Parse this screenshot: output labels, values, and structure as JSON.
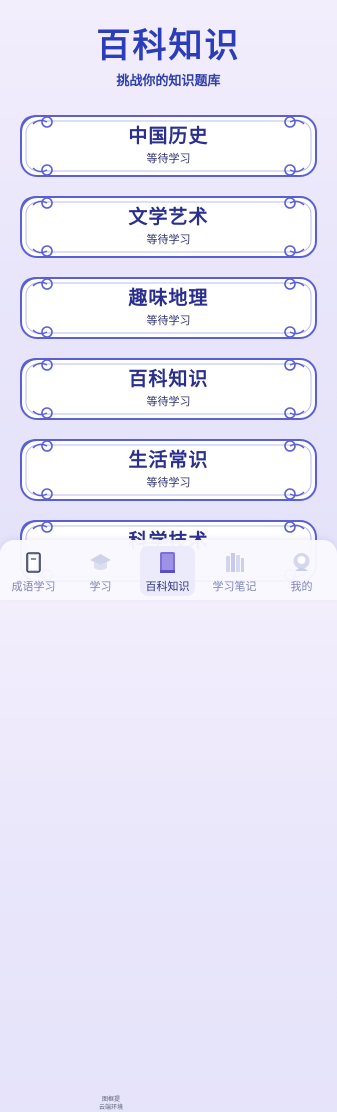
{
  "header": {
    "title": "百科知识",
    "subtitle": "挑战你的知识题库"
  },
  "categories": [
    {
      "name": "中国历史",
      "status": "等待学习"
    },
    {
      "name": "文学艺术",
      "status": "等待学习"
    },
    {
      "name": "趣味地理",
      "status": "等待学习"
    },
    {
      "name": "百科知识",
      "status": "等待学习"
    },
    {
      "name": "生活常识",
      "status": "等待学习"
    },
    {
      "name": "科学技术",
      "status": ""
    }
  ],
  "tabbar": {
    "items": [
      {
        "label": "成语学习",
        "icon": "book-icon"
      },
      {
        "label": "学习",
        "icon": "graduation-cap-icon"
      },
      {
        "label": "百科知识",
        "icon": "encyclopedia-book-icon"
      },
      {
        "label": "学习笔记",
        "icon": "bookshelf-icon"
      },
      {
        "label": "我的",
        "icon": "user-avatar-icon"
      }
    ],
    "active_index": 2,
    "overlay_note_line1": "图框提",
    "overlay_note_line2": "云端环境"
  },
  "colors": {
    "title": "#2b3db8",
    "card_border": "#5b5fd6",
    "card_fill": "#ffffff",
    "tab_active": "#2d3480",
    "tab_inactive": "#7f86b8"
  }
}
